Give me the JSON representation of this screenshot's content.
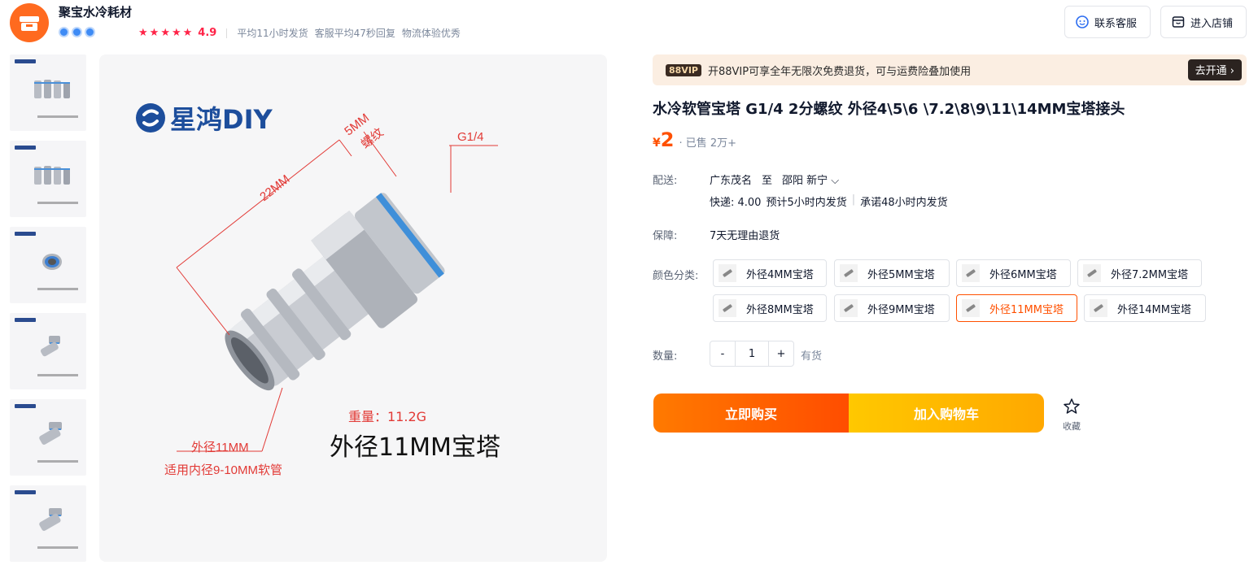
{
  "shop": {
    "name": "聚宝水冷耗材",
    "rating": "4.9",
    "stats": [
      "平均11小时发货",
      "客服平均47秒回复",
      "物流体验优秀"
    ],
    "buttons": {
      "service": "联系客服",
      "store": "进入店铺"
    }
  },
  "image": {
    "brand": "星鸿DIY",
    "labels": {
      "length": "22MM",
      "thread_len": "5MM",
      "thread": "螺纹",
      "thread_type": "G1/4",
      "outer": "外径11MM",
      "inner": "适用内径9-10MM软管",
      "weight": "重量：11.2G",
      "model": "外径11MM宝塔"
    }
  },
  "vip": {
    "badge": "88VIP",
    "text": "开88VIP可享全年无限次免费退货，可与运费险叠加使用",
    "cta": "去开通 ›"
  },
  "product": {
    "title": "水冷软管宝塔 G1/4 2分螺纹 外径4\\5\\6 \\7.2\\8\\9\\11\\14MM宝塔接头",
    "price_symbol": "¥",
    "price": "2",
    "sold": "· 已售 2万+"
  },
  "shipping": {
    "label": "配送:",
    "from": "广东茂名",
    "to_word": "至",
    "to": "邵阳 新宁 ⌵",
    "express": "快递: 4.00",
    "eta": "预计5小时内发货",
    "promise": "承诺48小时内发货"
  },
  "guarantee": {
    "label": "保障:",
    "value": "7天无理由退货"
  },
  "sku": {
    "label": "颜色分类:",
    "options": [
      "外径4MM宝塔",
      "外径5MM宝塔",
      "外径6MM宝塔",
      "外径7.2MM宝塔",
      "外径8MM宝塔",
      "外径9MM宝塔",
      "外径11MM宝塔",
      "外径14MM宝塔"
    ],
    "selected": "外径11MM宝塔"
  },
  "quantity": {
    "label": "数量:",
    "minus": "-",
    "value": "1",
    "plus": "+",
    "stock": "有货"
  },
  "actions": {
    "buy": "立即购买",
    "cart": "加入购物车",
    "favorite": "收藏"
  },
  "colors": {
    "accent": "#ff5000",
    "cart": "#ffb400",
    "brand": "#1d4e9c"
  }
}
